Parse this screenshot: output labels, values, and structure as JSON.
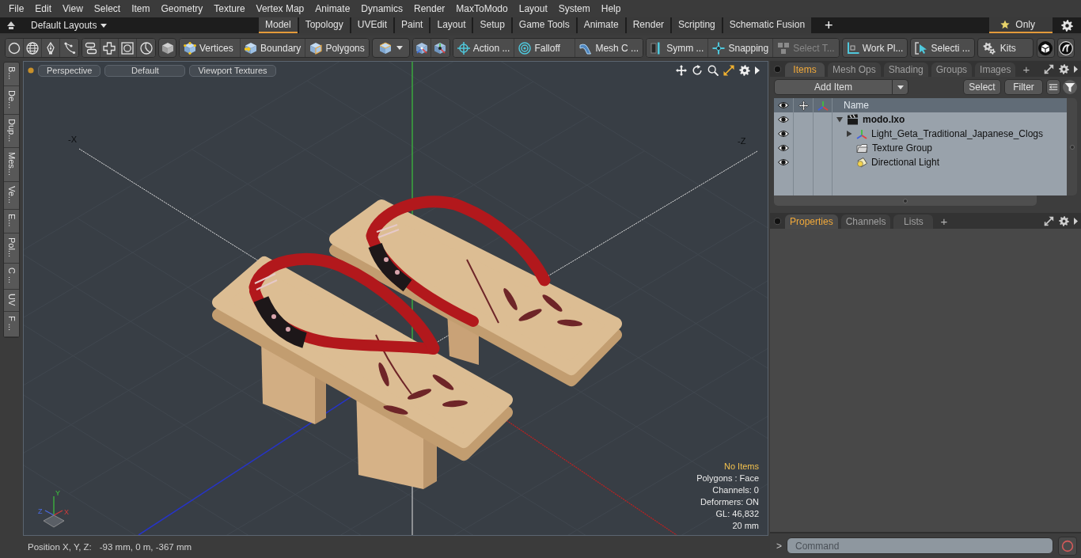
{
  "menu_bar": {
    "items": [
      "File",
      "Edit",
      "View",
      "Select",
      "Item",
      "Geometry",
      "Texture",
      "Vertex Map",
      "Animate",
      "Dynamics",
      "Render",
      "MaxToModo",
      "Layout",
      "System",
      "Help"
    ]
  },
  "layout_bar": {
    "layouts_menu": "Default Layouts",
    "tabs": [
      {
        "label": "Model",
        "selected": true
      },
      {
        "label": "Topology",
        "selected": false
      },
      {
        "label": "UVEdit",
        "selected": false
      },
      {
        "label": "Paint",
        "selected": false
      },
      {
        "label": "Layout",
        "selected": false
      },
      {
        "label": "Setup",
        "selected": false
      },
      {
        "label": "Game Tools",
        "selected": false
      },
      {
        "label": "Animate",
        "selected": false
      },
      {
        "label": "Render",
        "selected": false
      },
      {
        "label": "Scripting",
        "selected": false
      },
      {
        "label": "Schematic Fusion",
        "selected": false
      }
    ],
    "add_tab": "+",
    "only_toggle": {
      "label": "Only",
      "on": true
    }
  },
  "toolbar": {
    "selection_modes": [
      {
        "label": "Vertices"
      },
      {
        "label": "Boundary"
      },
      {
        "label": "Polygons"
      }
    ],
    "tool_groups": [
      {
        "buttons": [
          {
            "label": "Action ...",
            "disabled": false
          },
          {
            "label": "Falloff",
            "disabled": false
          },
          {
            "label": "Mesh C ...",
            "disabled": false
          }
        ]
      },
      {
        "buttons": [
          {
            "label": "Symm ...",
            "disabled": false
          },
          {
            "label": "Snapping",
            "disabled": false
          },
          {
            "label": "Select T...",
            "disabled": true
          }
        ]
      },
      {
        "buttons": [
          {
            "label": "Work Pl...",
            "disabled": false
          }
        ]
      },
      {
        "buttons": [
          {
            "label": "Selecti ...",
            "disabled": false
          }
        ]
      }
    ],
    "kits_button": "Kits"
  },
  "left_tabs": [
    "B...",
    "De...",
    "Dup...",
    "Mes...",
    "Ve...",
    "E...",
    "Pol...",
    "C ...",
    "UV",
    "F ..."
  ],
  "viewport": {
    "header_buttons": [
      "Perspective",
      "Default",
      "Viewport Textures"
    ],
    "axis_labels": [
      "-X",
      "-Z"
    ],
    "gizmo_labels": [
      "Y",
      "Z",
      "X"
    ],
    "info": [
      {
        "text": "No Items",
        "kind": "highlight"
      },
      {
        "text": "Polygons : Face",
        "kind": "plain"
      },
      {
        "text": "Channels: 0",
        "kind": "plain"
      },
      {
        "text": "Deformers: ON",
        "kind": "plain"
      },
      {
        "text": "GL: 46,832",
        "kind": "plain"
      },
      {
        "text": "20 mm",
        "kind": "plain"
      }
    ]
  },
  "items_panel": {
    "tabs": [
      {
        "label": "Items",
        "selected": true
      },
      {
        "label": "Mesh Ops",
        "selected": false
      },
      {
        "label": "Shading",
        "selected": false
      },
      {
        "label": "Groups",
        "selected": false
      },
      {
        "label": "Images",
        "selected": false
      }
    ],
    "add_tab": "+",
    "add_item_button": "Add Item",
    "select_button": "Select",
    "filter_button": "Filter",
    "tree": {
      "column_name": "Name",
      "items": [
        {
          "label": "modo.lxo",
          "kind": "scene",
          "visible": true,
          "expanded": true,
          "children": [
            {
              "label": "Light_Geta_Traditional_Japanese_Clogs",
              "kind": "mesh",
              "visible": true,
              "expanded": false
            },
            {
              "label": "Texture Group",
              "kind": "group",
              "visible": true
            },
            {
              "label": "Directional Light",
              "kind": "light",
              "visible": true
            }
          ]
        }
      ]
    }
  },
  "properties_panel": {
    "tabs": [
      {
        "label": "Properties",
        "selected": true
      },
      {
        "label": "Channels",
        "selected": false
      },
      {
        "label": "Lists",
        "selected": false
      }
    ],
    "add_tab": "+"
  },
  "status_bar": {
    "label": "Position X, Y, Z:",
    "value": "-93 mm, 0 m, -367 mm"
  },
  "command_bar": {
    "prompt": ">",
    "placeholder": "Command"
  }
}
